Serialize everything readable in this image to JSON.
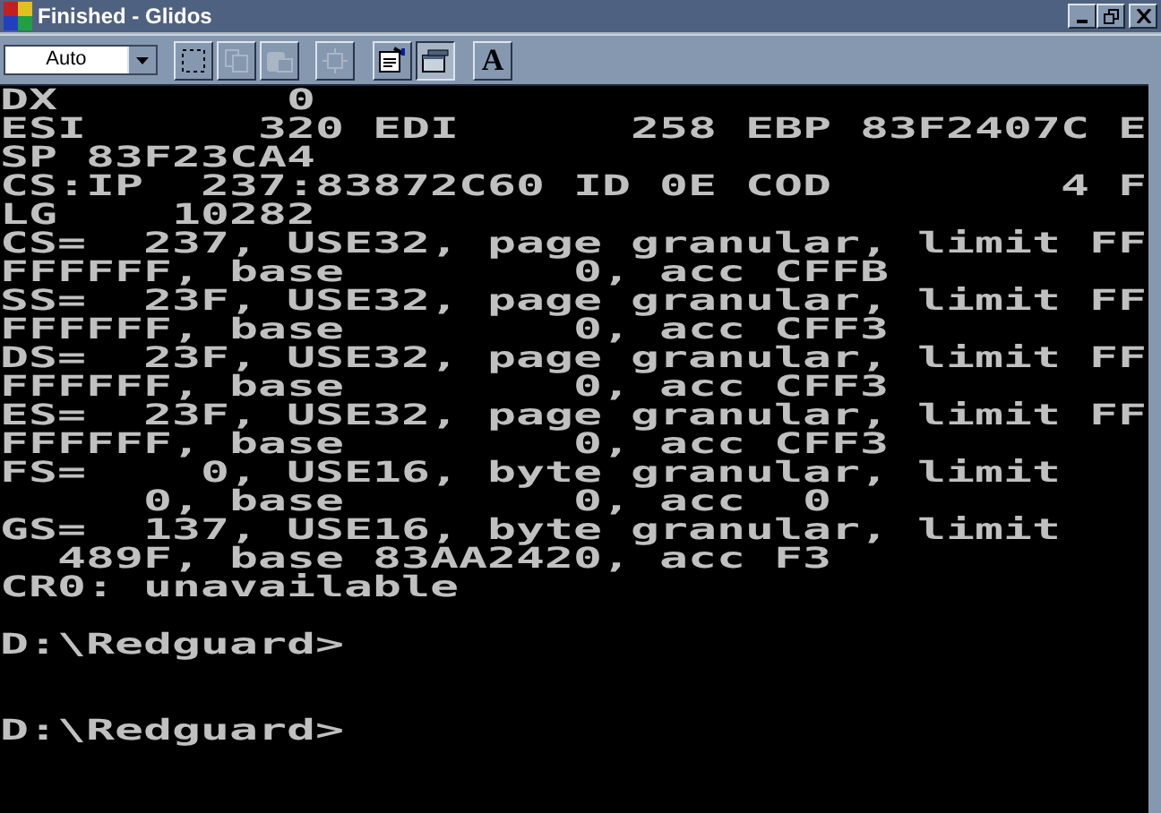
{
  "window": {
    "title": "Finished - Glidos"
  },
  "toolbar": {
    "font_size": {
      "value": "Auto"
    },
    "buttons": [
      {
        "kind": "select",
        "disabled": false,
        "pressed": false
      },
      {
        "kind": "copy",
        "disabled": true,
        "pressed": false
      },
      {
        "kind": "paste",
        "disabled": true,
        "pressed": false
      },
      {
        "kind": "fullscreen",
        "disabled": true,
        "pressed": false
      },
      {
        "kind": "properties",
        "disabled": false,
        "pressed": false
      },
      {
        "kind": "background",
        "disabled": false,
        "pressed": true
      },
      {
        "kind": "font",
        "label": "A",
        "disabled": false,
        "pressed": false
      }
    ]
  },
  "console": {
    "text": "DX        0\nESI      320 EDI      258 EBP 83F2407C E\nSP 83F23CA4\nCS:IP  237:83872C60 ID 0E COD        4 F\nLG    10282\nCS=  237, USE32, page granular, limit FF\nFFFFFF, base        0, acc CFFB\nSS=  23F, USE32, page granular, limit FF\nFFFFFF, base        0, acc CFF3\nDS=  23F, USE32, page granular, limit FF\nFFFFFF, base        0, acc CFF3\nES=  23F, USE32, page granular, limit FF\nFFFFFF, base        0, acc CFF3\nFS=    0, USE16, byte granular, limit\n     0, base        0, acc  0\nGS=  137, USE16, byte granular, limit\n  489F, base 83AA2420, acc F3\nCR0: unavailable\n\nD:\\Redguard>\n\n\nD:\\Redguard>"
  }
}
